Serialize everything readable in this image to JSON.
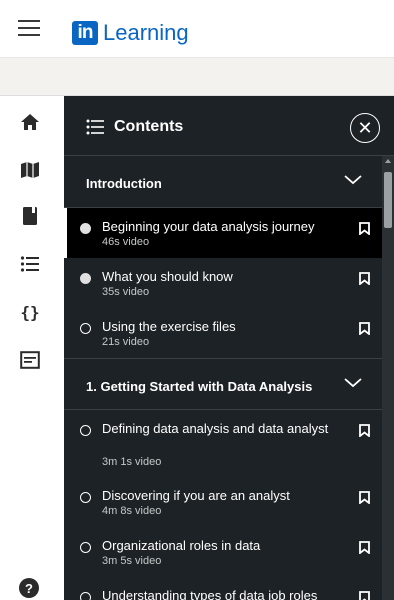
{
  "header": {
    "logo_mark": "in",
    "logo_text": "Learning"
  },
  "left_nav": {
    "icons": [
      "home-icon",
      "map-icon",
      "notebook-icon",
      "list-icon",
      "code-icon",
      "transcript-icon",
      "help-icon"
    ],
    "help_glyph": "?"
  },
  "panel": {
    "title": "Contents",
    "close_glyph": "✕",
    "sections": [
      {
        "title": "Introduction",
        "items": [
          {
            "title": "Beginning your data analysis journey",
            "meta": "46s video",
            "status": "viewed",
            "active": true
          },
          {
            "title": "What you should know",
            "meta": "35s video",
            "status": "viewed",
            "active": false
          },
          {
            "title": "Using the exercise files",
            "meta": "21s video",
            "status": "unviewed",
            "active": false
          }
        ]
      },
      {
        "title": "1. Getting Started with Data Analysis",
        "items": [
          {
            "title": "Defining data analysis and data analyst",
            "meta": "3m 1s video",
            "status": "unviewed",
            "active": false
          },
          {
            "title": "Discovering if you are an analyst",
            "meta": "4m 8s video",
            "status": "unviewed",
            "active": false
          },
          {
            "title": "Organizational roles in data",
            "meta": "3m 5s video",
            "status": "unviewed",
            "active": false
          },
          {
            "title": "Understanding types of data job roles",
            "meta": "",
            "status": "unviewed",
            "active": false
          }
        ]
      }
    ]
  },
  "colors": {
    "brand": "#0a66c2",
    "panel_bg": "#1d2226",
    "active_bg": "#000000"
  }
}
